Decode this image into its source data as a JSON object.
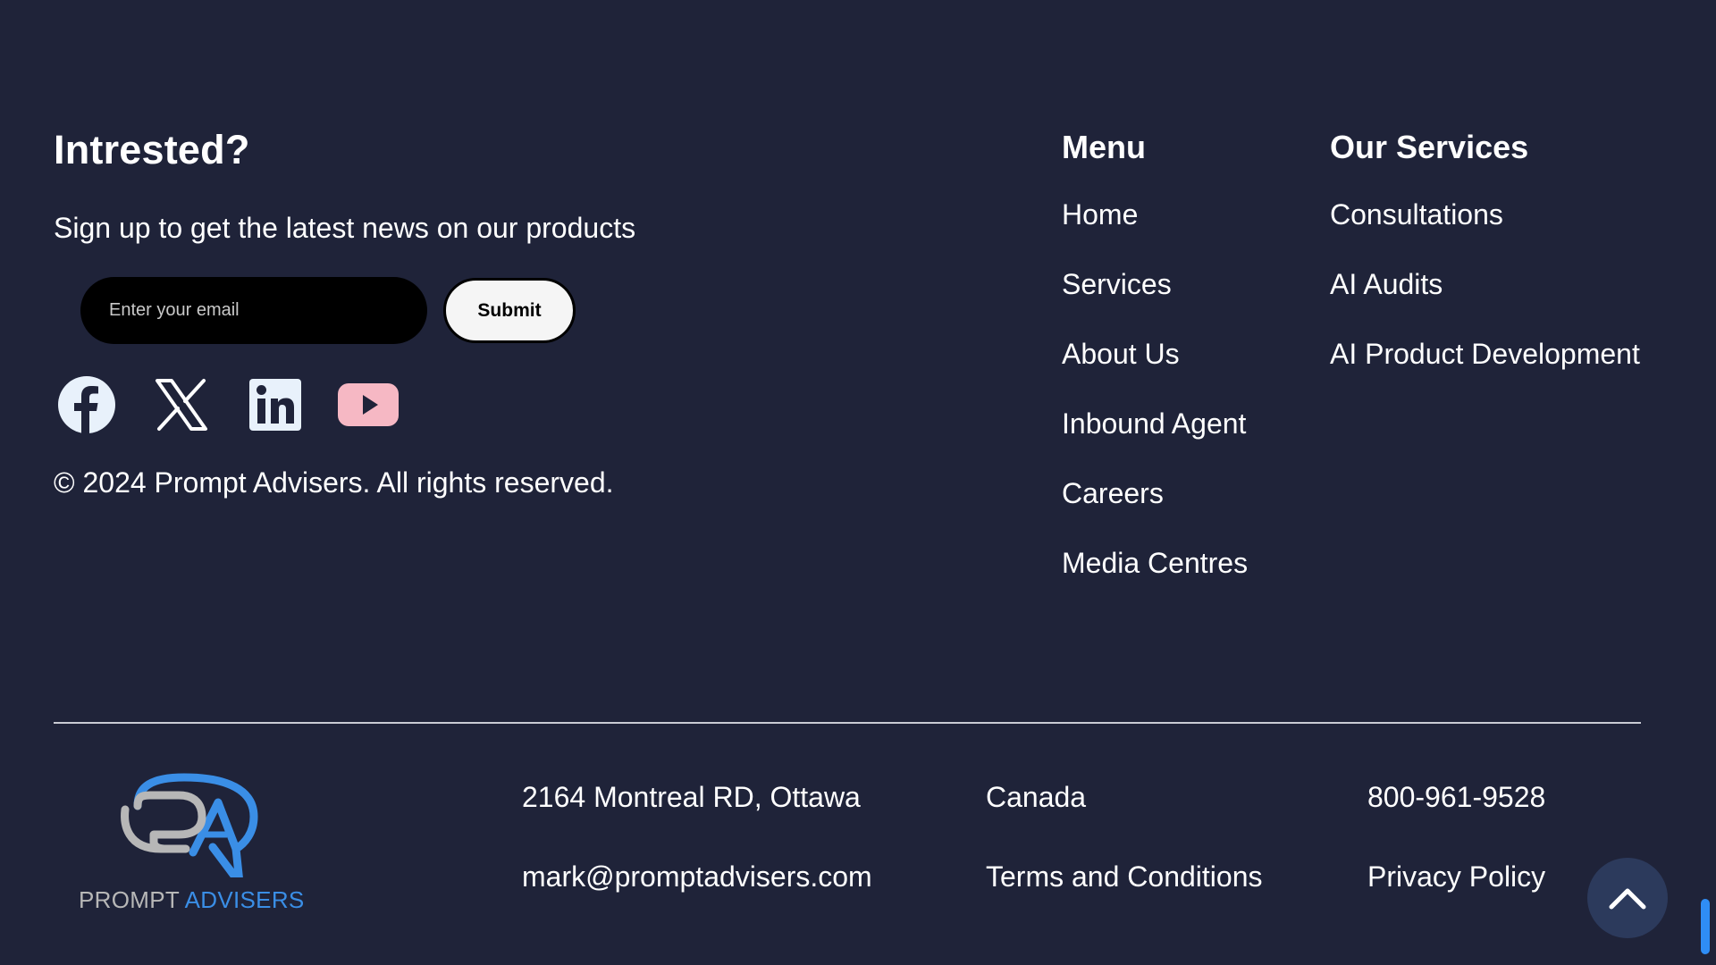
{
  "signup": {
    "heading": "Intrested?",
    "tagline": "Sign up to get the latest news on our products",
    "email_placeholder": "Enter your email",
    "submit_label": "Submit"
  },
  "social": [
    {
      "icon": "facebook-icon"
    },
    {
      "icon": "x-icon"
    },
    {
      "icon": "linkedin-icon"
    },
    {
      "icon": "youtube-icon"
    }
  ],
  "copyright": "© 2024 Prompt Advisers. All rights reserved.",
  "menu": {
    "title": "Menu",
    "items": [
      "Home",
      "Services",
      "About Us",
      "Inbound Agent",
      "Careers",
      "Media Centres"
    ]
  },
  "services": {
    "title": "Our Services",
    "items": [
      "Consultations",
      "AI Audits",
      "AI Product Development"
    ]
  },
  "logo": {
    "word1": "PROMPT",
    "word2": "ADVISERS",
    "color_gray": "#b7b7b7",
    "color_blue": "#3a8ee6"
  },
  "contact": {
    "address": "2164 Montreal RD, Ottawa",
    "country": "Canada",
    "phone": "800-961-9528",
    "email": "mark@promptadvisers.com",
    "terms": "Terms and Conditions",
    "privacy": "Privacy Policy"
  },
  "colors": {
    "background": "#1f2339",
    "accent": "#2f8df5",
    "youtube": "#f6b8c4"
  }
}
